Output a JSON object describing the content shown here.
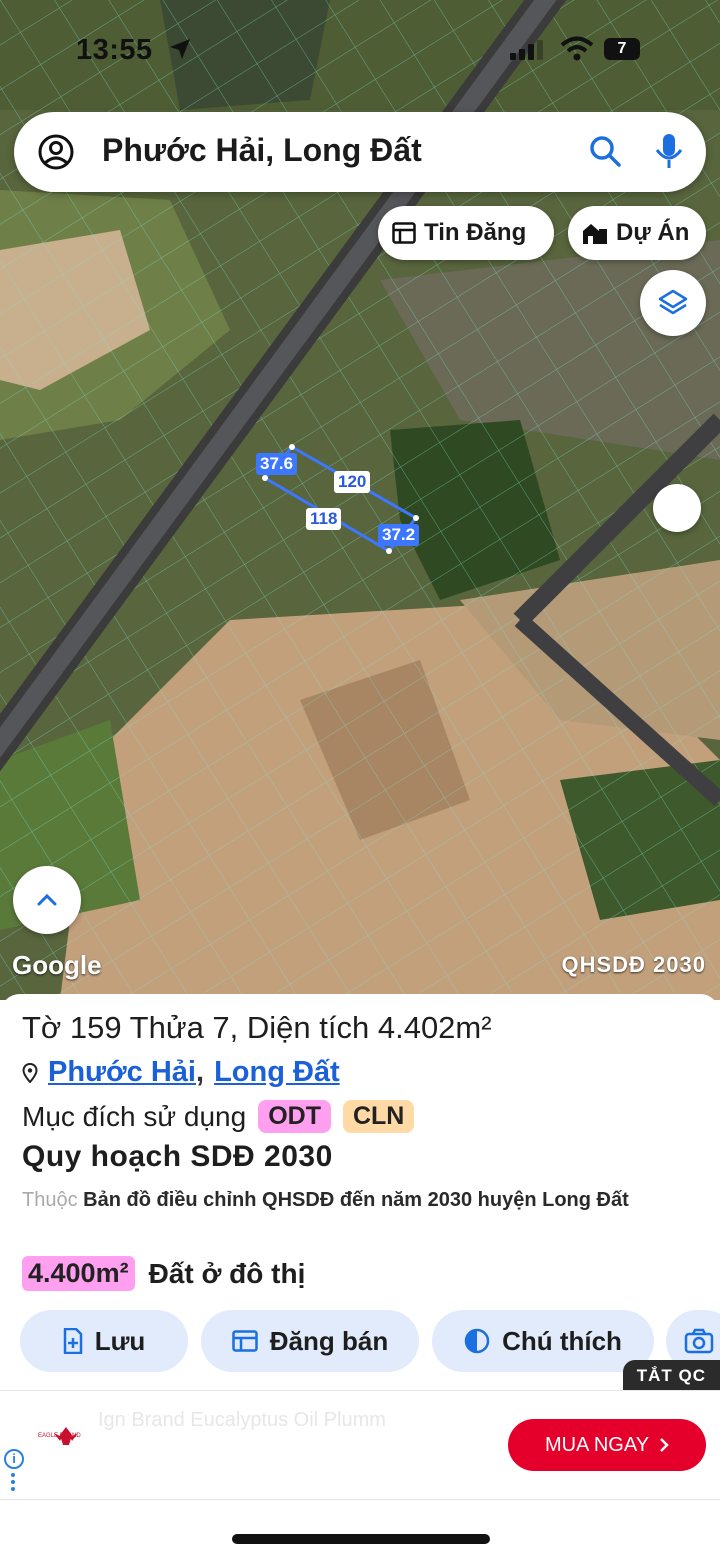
{
  "status_bar": {
    "time": "13:55",
    "battery": "7"
  },
  "search": {
    "query": "Phước Hải, Long Đất"
  },
  "map_chips": {
    "listings": "Tin Đăng",
    "projects": "Dự Án"
  },
  "map": {
    "watermark_left": "Google",
    "watermark_right": "QHSDĐ 2030",
    "dimensions": {
      "top_left": "37.6",
      "top": "120",
      "bottom": "118",
      "right": "37.2"
    }
  },
  "parcel": {
    "title": "Tờ 159 Thửa 7, Diện tích 4.402m²",
    "ward": "Phước Hải",
    "separator": ",",
    "district": "Long Đất",
    "purpose_label": "Mục đích sử dụng",
    "purpose_tags": [
      "ODT",
      "CLN"
    ],
    "plan_title": "Quy hoạch SDĐ 2030",
    "plan_prefix": "Thuộc",
    "plan_desc": "Bản đồ điều chỉnh QHSDĐ đến năm 2030 huyện Long Đất",
    "area_value": "4.400m²",
    "area_label": "Đất ở đô thị"
  },
  "actions": {
    "save": "Lưu",
    "post": "Đăng bán",
    "legend": "Chú thích"
  },
  "ad": {
    "close_label": "TẮT QC",
    "brand": "EAGLE BRAND",
    "ghost_text": "Ign Brand Eucalyptus Oil Plumm",
    "cta": "MUA NGAY"
  },
  "colors": {
    "accent": "#1b5fd9",
    "odt": "#ff9ff0",
    "cln": "#ffd9a6",
    "cta": "#e4002b",
    "parcel_line": "#3d77ff"
  }
}
